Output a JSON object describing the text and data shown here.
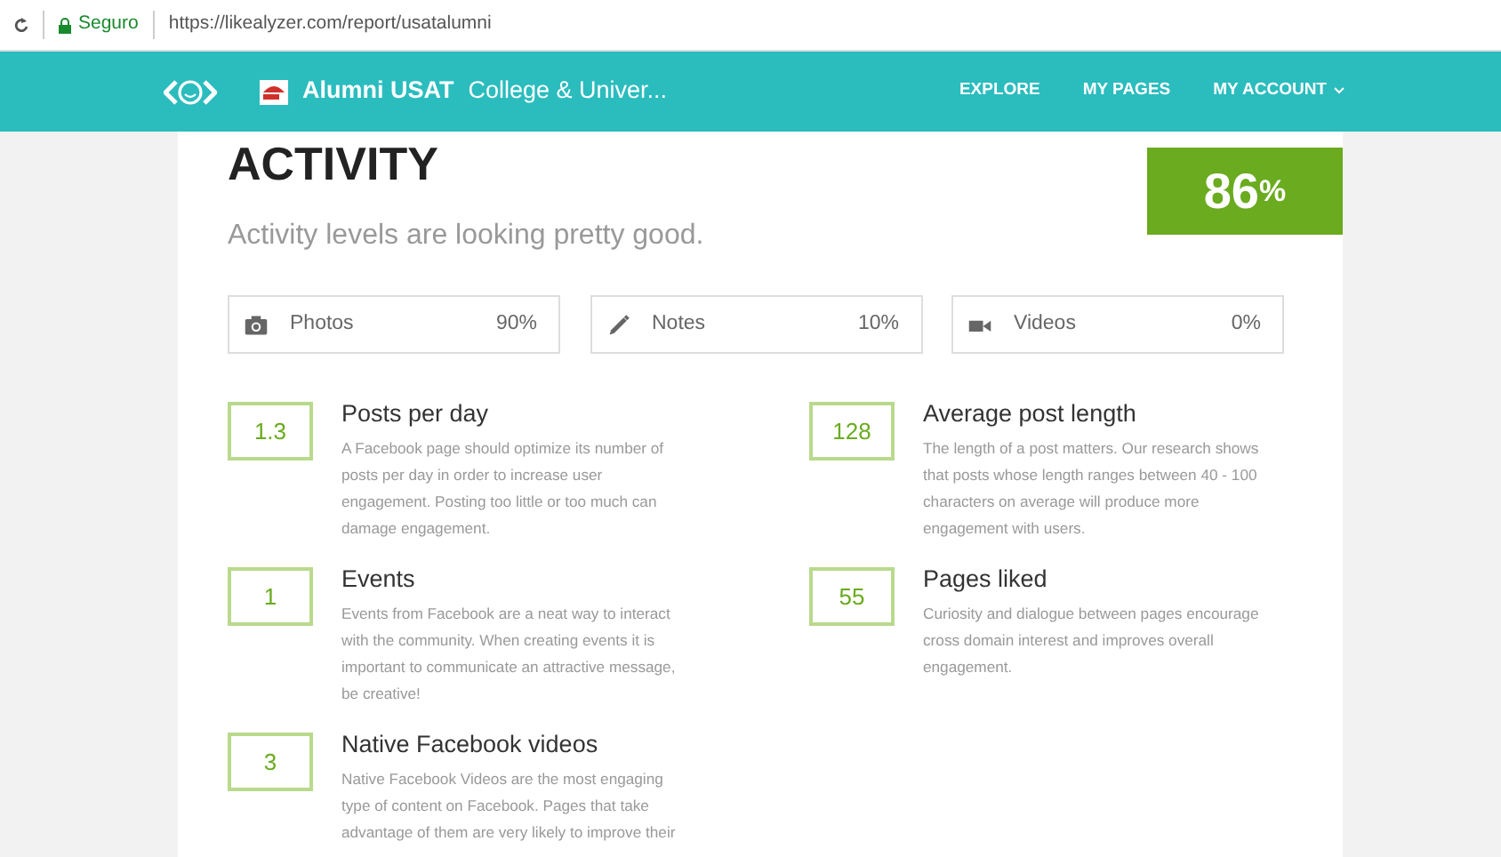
{
  "address_bar": {
    "security": "Seguro",
    "url": "https://likealyzer.com/report/usatalumni"
  },
  "navbar": {
    "page_name": "Alumni USAT",
    "category": "College & Univer...",
    "links": [
      {
        "label": "EXPLORE",
        "dropdown": false
      },
      {
        "label": "MY PAGES",
        "dropdown": false
      },
      {
        "label": "MY ACCOUNT",
        "dropdown": true
      }
    ]
  },
  "section": {
    "title": "ACTIVITY",
    "subtitle": "Activity levels are looking pretty good.",
    "score": "86",
    "score_unit": "%"
  },
  "content_types": [
    {
      "kind": "photo",
      "label": "Photos",
      "value": "90%"
    },
    {
      "kind": "note",
      "label": "Notes",
      "value": "10%"
    },
    {
      "kind": "video",
      "label": "Videos",
      "value": "0%"
    }
  ],
  "metrics": [
    {
      "value": "1.3",
      "title": "Posts per day",
      "description": "A Facebook page should optimize its number of posts per day in order to increase user engagement. Posting too little or too much can damage engagement."
    },
    {
      "value": "128",
      "title": "Average post length",
      "description": "The length of a post matters. Our research shows that posts whose length ranges between 40 - 100 characters on average will produce more engagement with users."
    },
    {
      "value": "1",
      "title": "Events",
      "description": "Events from Facebook are a neat way to interact with the community. When creating events it is important to communicate an attractive message, be creative!"
    },
    {
      "value": "55",
      "title": "Pages liked",
      "description": "Curiosity and dialogue between pages encourage cross domain interest and improves overall engagement."
    },
    {
      "value": "3",
      "title": "Native Facebook videos",
      "description": "Native Facebook Videos are the most engaging type of content on Facebook. Pages that take advantage of them are very likely to improve their"
    }
  ]
}
